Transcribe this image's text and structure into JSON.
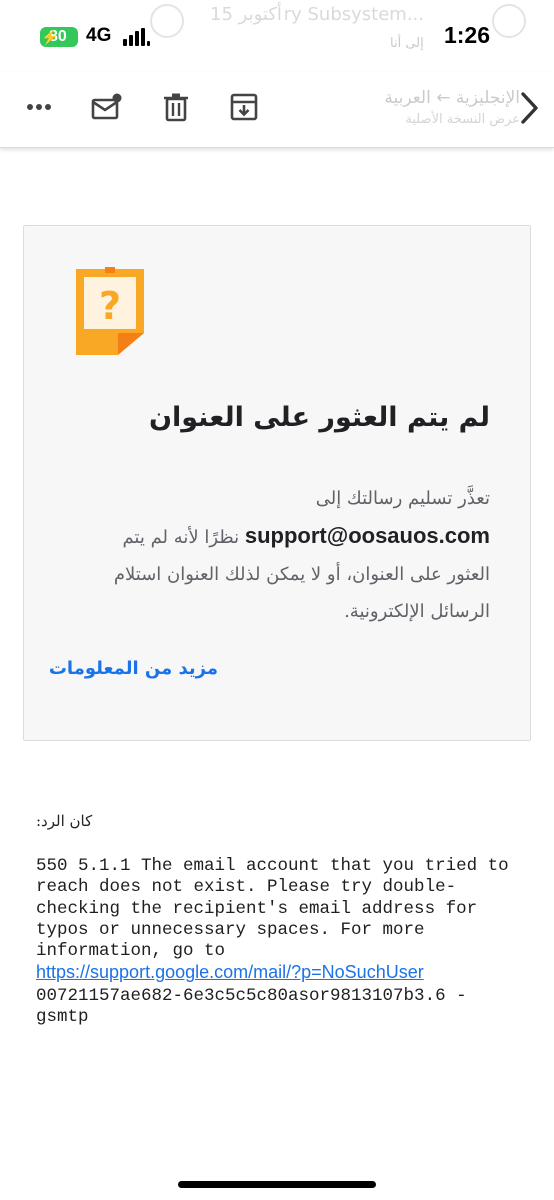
{
  "status_bar": {
    "battery": "80",
    "network": "4G",
    "time": "1:26"
  },
  "background_header": {
    "subject": "ry Subsystem...",
    "date": "15 أكتوبر",
    "recipient": "إلى أنا",
    "translate_title": "الإنجليزية ← العربية",
    "translate_sub": "عرض النسخة الأصلية"
  },
  "toolbar": {
    "icons": [
      "more-icon",
      "mark-unread-icon",
      "delete-icon",
      "archive-icon",
      "next-icon"
    ]
  },
  "bounce_card": {
    "title": "لم يتم العثور على العنوان",
    "body_before": "تعذَّر تسليم رسالتك إلى",
    "address": "support@oosauos.com",
    "body_after": "نظرًا لأنه لم يتم العثور على العنوان، أو لا يمكن لذلك العنوان استلام الرسائل الإلكترونية.",
    "more_info": "مزيد من المعلومات",
    "icon_colors": {
      "note": "#f9a825",
      "fold": "#f57f17",
      "inner": "#fff3e0"
    }
  },
  "response": {
    "label": "كان الرد:",
    "line1": "550 5.1.1 The email account that you tried to reach does not exist. Please try double-checking the recipient's email address for typos or unnecessary spaces. For more information, go to",
    "link": "https://support.google.com/mail/?p=NoSuchUser",
    "line2": "00721157ae682-6e3c5c5c80asor9813107b3.6 - gsmtp"
  }
}
